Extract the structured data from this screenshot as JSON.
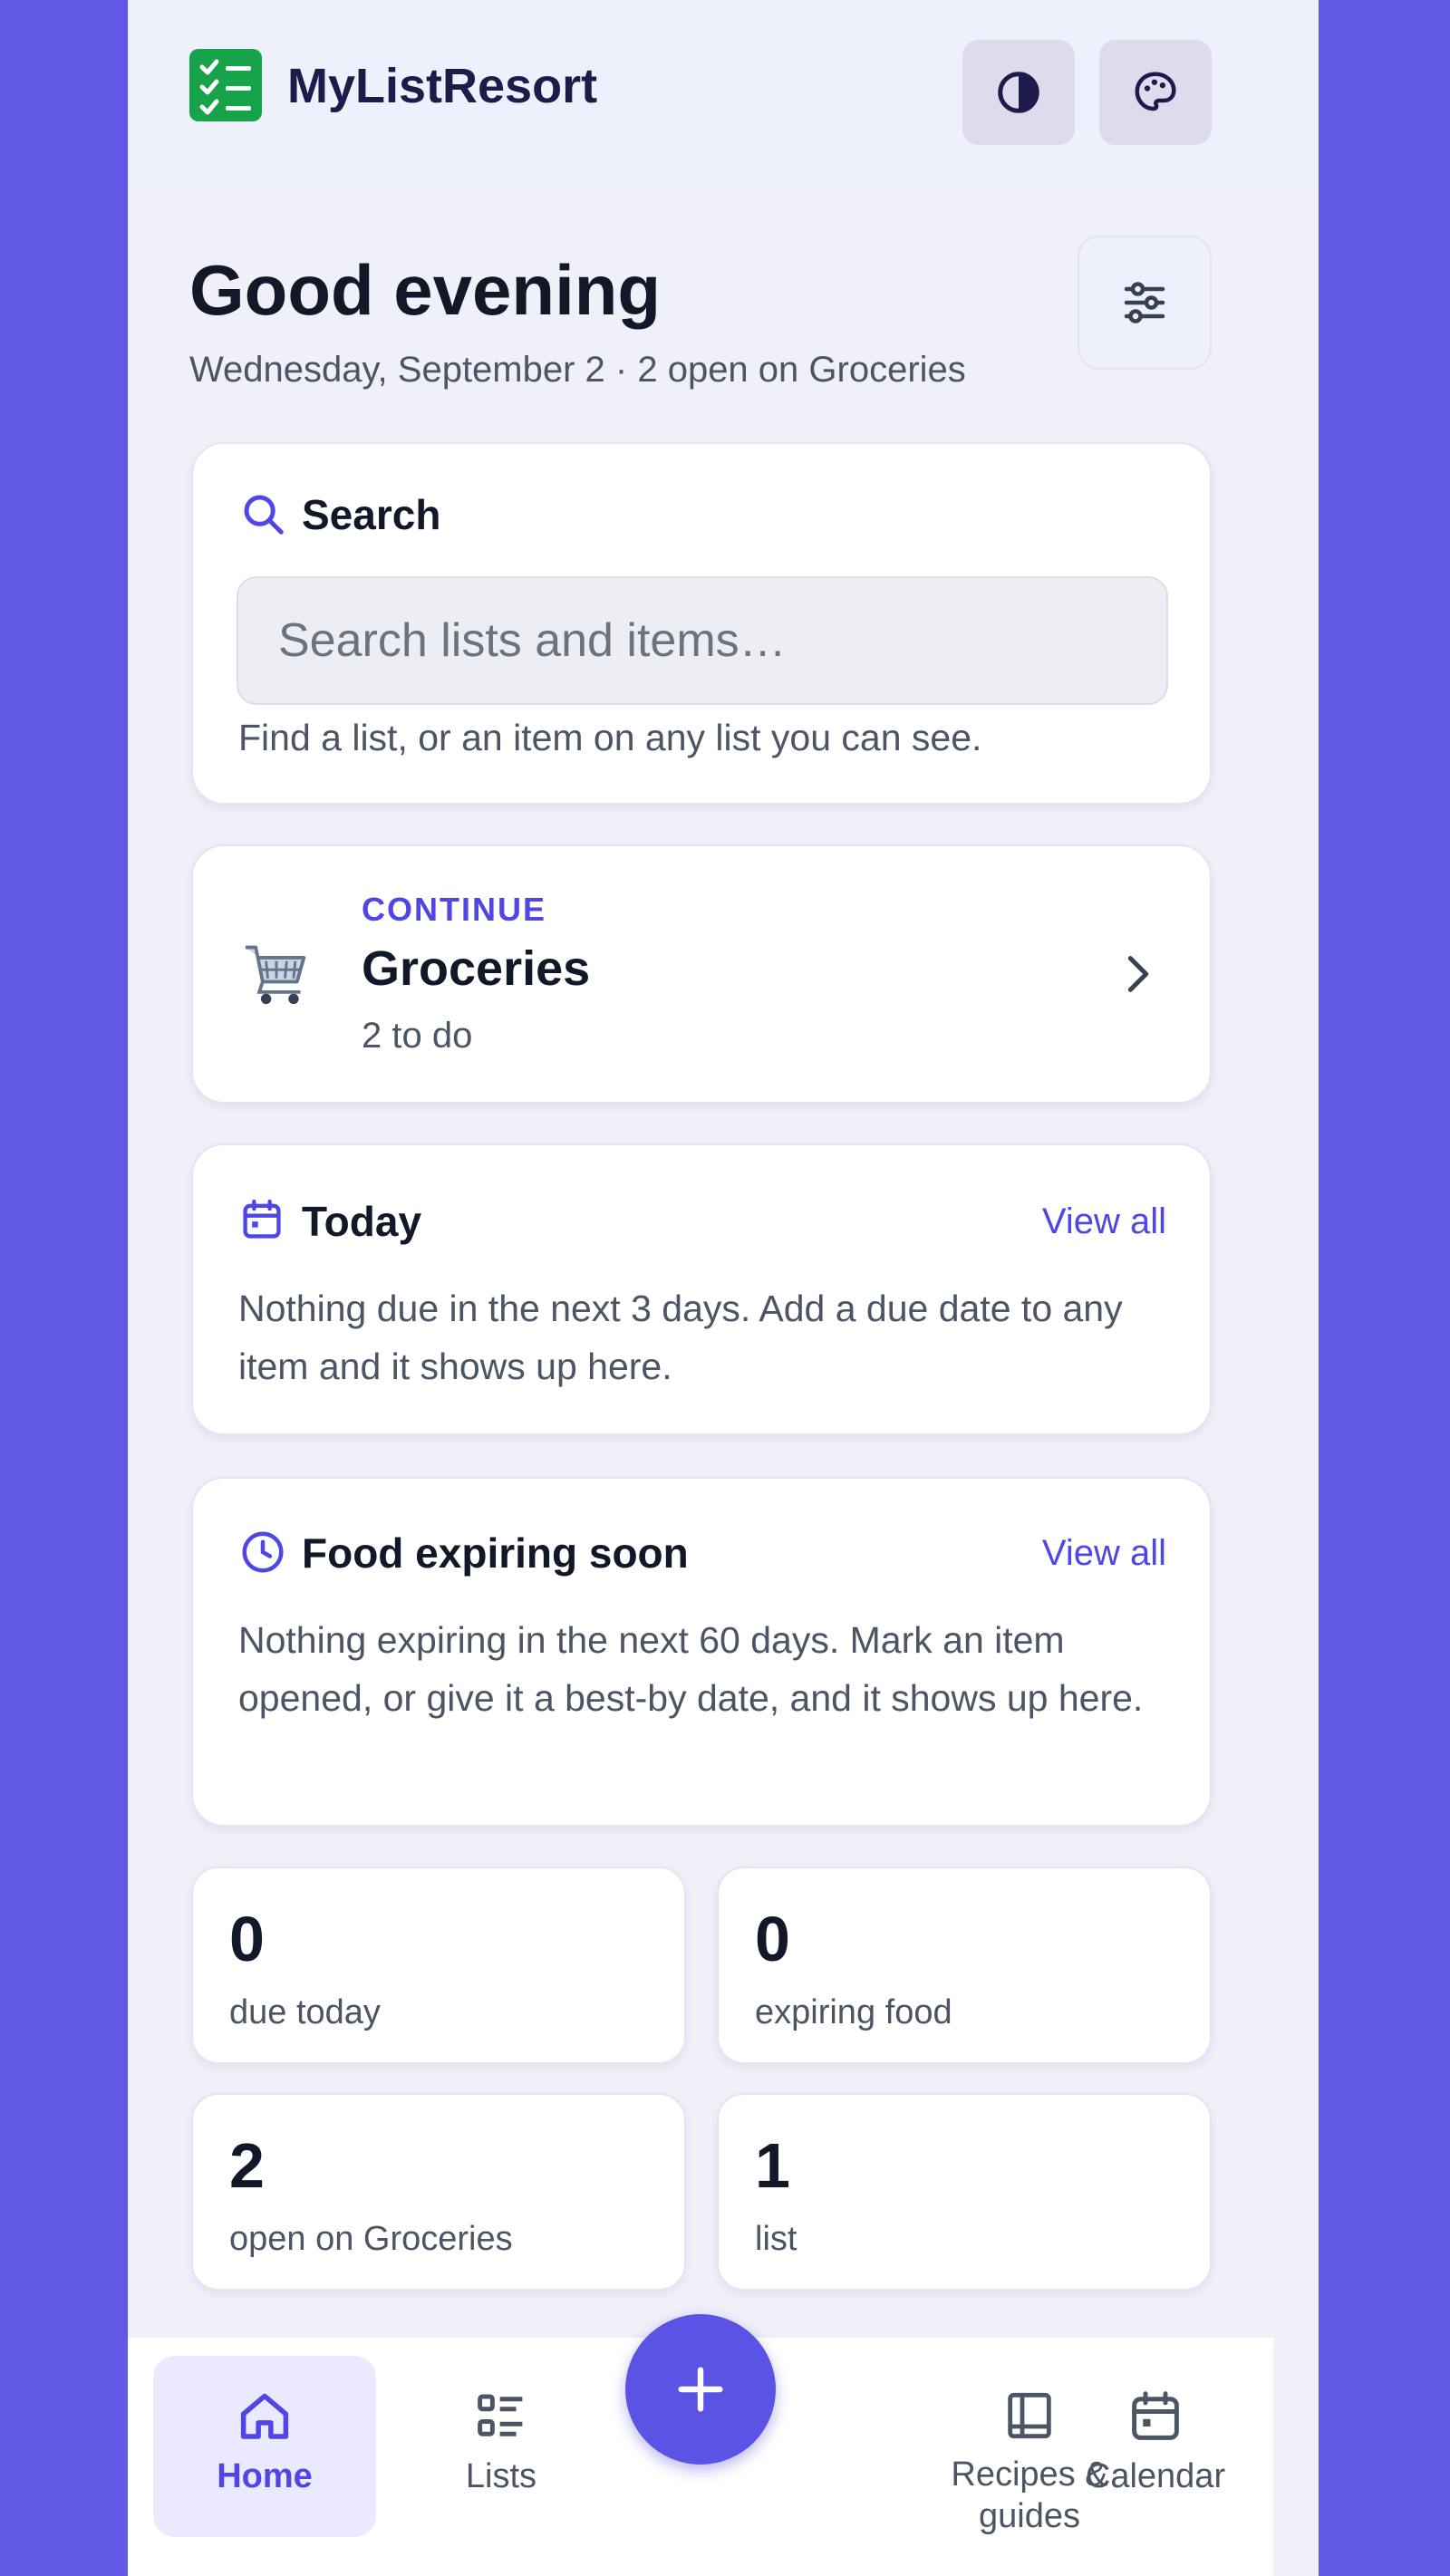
{
  "header": {
    "brand": "MyListResort",
    "logo_icon": "checklist-logo-icon",
    "theme_icon": "contrast-icon",
    "palette_icon": "palette-icon"
  },
  "greeting": {
    "title": "Good evening",
    "subtitle": "Wednesday, September 2 · 2 open on Groceries",
    "filter_icon": "sliders-icon"
  },
  "search": {
    "title": "Search",
    "placeholder": "Search lists and items…",
    "value": "",
    "hint": "Find a list, or an item on any list you can see."
  },
  "continue": {
    "eyebrow": "CONTINUE",
    "title": "Groceries",
    "detail": "2 to do",
    "icon": "shopping-cart-icon"
  },
  "today": {
    "title": "Today",
    "view_all": "View all",
    "text": "Nothing due in the next 3 days. Add a due date to any item and it shows up here."
  },
  "expiring": {
    "title": "Food expiring soon",
    "view_all": "View all",
    "text": "Nothing expiring in the next 60 days. Mark an item opened, or give it a best-by date, and it shows up here."
  },
  "stats": [
    {
      "value": "0",
      "label": "due today"
    },
    {
      "value": "0",
      "label": "expiring food"
    },
    {
      "value": "2",
      "label": "open on Groceries"
    },
    {
      "value": "1",
      "label": "list"
    }
  ],
  "nav": {
    "items": [
      {
        "label": "Home",
        "icon": "home-icon",
        "active": true
      },
      {
        "label": "Lists",
        "icon": "list-icon",
        "active": false
      },
      {
        "label": "Recipes & guides",
        "icon": "book-icon",
        "active": false
      },
      {
        "label": "Calendar",
        "icon": "calendar-icon",
        "active": false
      }
    ],
    "add_icon": "plus-icon"
  },
  "colors": {
    "accent": "#4f46e5",
    "background": "#6159e6",
    "logo": "#16a34a"
  }
}
